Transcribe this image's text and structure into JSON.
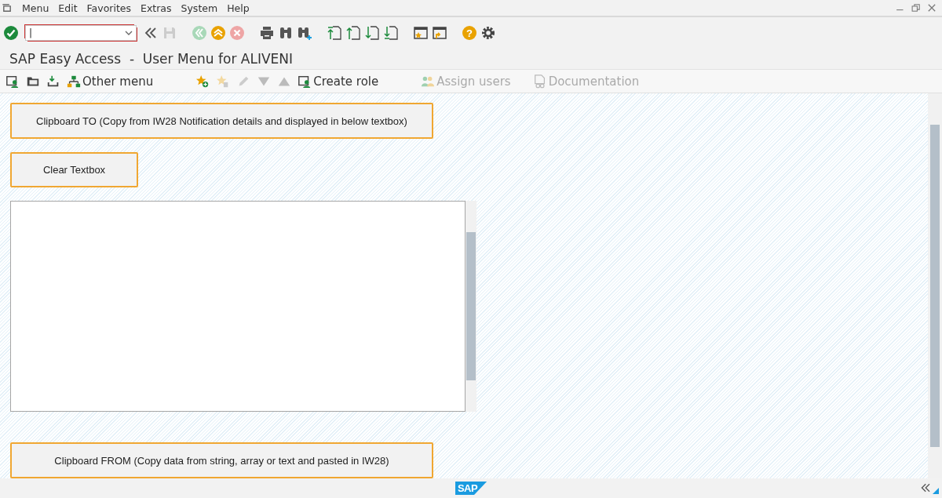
{
  "menu_bar": [
    {
      "label": "Menu"
    },
    {
      "label": "Edit"
    },
    {
      "label": "Favorites"
    },
    {
      "label": "Extras"
    },
    {
      "label": "System"
    },
    {
      "label": "Help"
    }
  ],
  "command_field": {
    "value": "|"
  },
  "screen_title": "SAP Easy Access  -  User Menu for ALIVENI",
  "app_toolbar": [
    {
      "label": "Other menu",
      "disabled": false
    },
    {
      "label": "Create role",
      "disabled": false
    },
    {
      "label": "Assign users",
      "disabled": true
    },
    {
      "label": "Documentation",
      "disabled": true
    }
  ],
  "buttons": [
    {
      "label": "Clipboard TO (Copy from IW28 Notification details and displayed in below textbox)"
    },
    {
      "label": "Clear Textbox"
    }
  ],
  "help_button": {
    "glyph": "?"
  },
  "bottom_button": {
    "label": "Clipboard FROM (Copy data from string, array or text and pasted in IW28)"
  },
  "status_bar": {
    "logo": "SAP"
  }
}
